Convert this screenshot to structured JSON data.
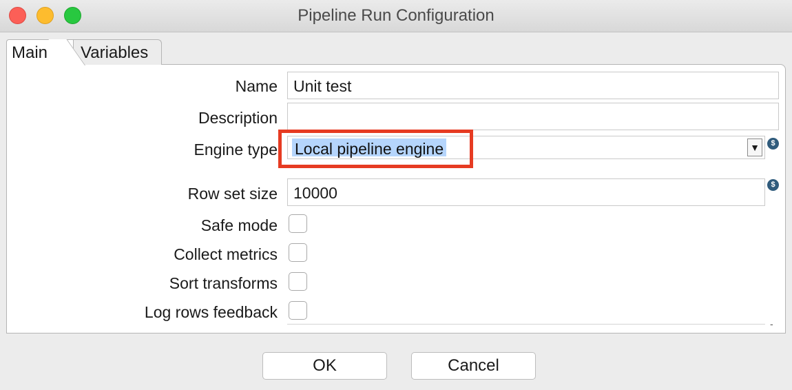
{
  "window": {
    "title": "Pipeline Run Configuration"
  },
  "tabs": [
    {
      "label": "Main"
    },
    {
      "label": "Variables"
    }
  ],
  "form": {
    "name": {
      "label": "Name",
      "value": "Unit test"
    },
    "description": {
      "label": "Description",
      "value": ""
    },
    "engine_type": {
      "label": "Engine type",
      "value": "Local pipeline engine"
    },
    "row_set_size": {
      "label": "Row set size",
      "value": "10000"
    },
    "safe_mode": {
      "label": "Safe mode"
    },
    "collect_metrics": {
      "label": "Collect metrics"
    },
    "sort_transforms": {
      "label": "Sort transforms"
    },
    "log_rows_feedback": {
      "label": "Log rows feedback"
    }
  },
  "buttons": {
    "ok": "OK",
    "cancel": "Cancel"
  },
  "icons": {
    "variable": "$",
    "dropdown": "▼"
  },
  "colors": {
    "highlight": "#e63b22",
    "selection": "#b5d5fc"
  }
}
